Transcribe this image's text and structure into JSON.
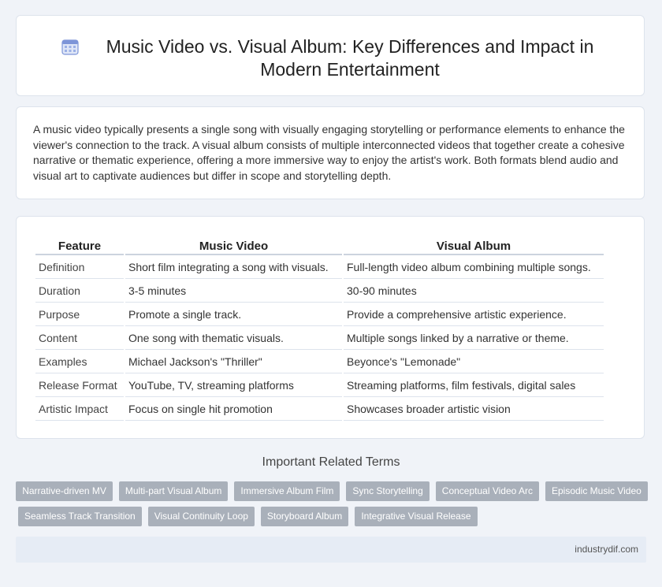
{
  "header": {
    "title": "Music Video vs. Visual Album: Key Differences and Impact in Modern Entertainment",
    "icon": "calendar-icon"
  },
  "intro": {
    "text": "A music video typically presents a single song with visually engaging storytelling or performance elements to enhance the viewer's connection to the track. A visual album consists of multiple interconnected videos that together create a cohesive narrative or thematic experience, offering a more immersive way to enjoy the artist's work. Both formats blend audio and visual art to captivate audiences but differ in scope and storytelling depth."
  },
  "table": {
    "headers": [
      "Feature",
      "Music Video",
      "Visual Album"
    ],
    "rows": [
      [
        "Definition",
        "Short film integrating a song with visuals.",
        "Full-length video album combining multiple songs."
      ],
      [
        "Duration",
        "3-5 minutes",
        "30-90 minutes"
      ],
      [
        "Purpose",
        "Promote a single track.",
        "Provide a comprehensive artistic experience."
      ],
      [
        "Content",
        "One song with thematic visuals.",
        "Multiple songs linked by a narrative or theme."
      ],
      [
        "Examples",
        "Michael Jackson's \"Thriller\"",
        "Beyonce's \"Lemonade\""
      ],
      [
        "Release Format",
        "YouTube, TV, streaming platforms",
        "Streaming platforms, film festivals, digital sales"
      ],
      [
        "Artistic Impact",
        "Focus on single hit promotion",
        "Showcases broader artistic vision"
      ]
    ]
  },
  "related": {
    "heading": "Important Related Terms",
    "row1": [
      "Narrative-driven MV",
      "Multi-part Visual Album",
      "Immersive Album Film",
      "Sync Storytelling",
      "Conceptual Video Arc",
      "Episodic Music Video"
    ],
    "row2": [
      "Seamless Track Transition",
      "Visual Continuity Loop",
      "Storyboard Album",
      "Integrative Visual Release"
    ]
  },
  "footer": {
    "source": "industrydif.com"
  },
  "colors": {
    "tag_bg": "#a9b0ba",
    "page_bg": "#f0f3f8",
    "footer_bg": "#e6ecf5"
  }
}
